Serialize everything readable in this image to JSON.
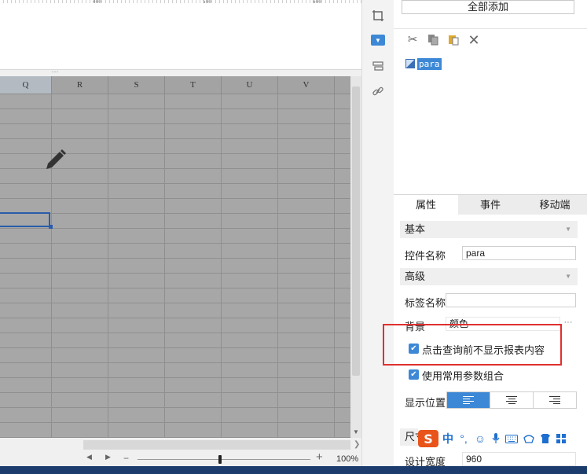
{
  "ruler": {
    "labels": [
      "400",
      "500",
      "600"
    ]
  },
  "grid": {
    "columns": [
      "Q",
      "R",
      "S",
      "T",
      "U",
      "V"
    ]
  },
  "zoom": {
    "minus": "−",
    "plus": "+",
    "percent": "100%",
    "level": 1.0
  },
  "tools": [
    "crop-icon",
    "widget-icon",
    "layers-icon",
    "link-icon"
  ],
  "right_panel": {
    "add_all_button": "全部添加",
    "edit_toolbar": [
      "cut-icon",
      "copy-icon",
      "paste-icon",
      "delete-icon"
    ],
    "tree": {
      "item_label": "para"
    },
    "tabs": [
      "属性",
      "事件",
      "移动端"
    ],
    "active_tab": "属性",
    "sections": {
      "basic": "基本",
      "advanced": "高级"
    },
    "fields": {
      "control_name_label": "控件名称",
      "control_name_value": "para",
      "tag_name_label": "标签名称",
      "tag_name_value": "",
      "background_label": "背景",
      "background_value": "颜色",
      "background_more": "···",
      "checkbox_hide_report": "点击查询前不显示报表内容",
      "checkbox_param_combo": "使用常用参数组合",
      "display_position_label": "显示位置",
      "size_section_label": "尺寸",
      "design_width_label": "设计宽度",
      "design_width_value": "960"
    },
    "ime_bar": {
      "logo": "S",
      "lang": "中",
      "punct": "°,"
    }
  },
  "colors": {
    "accent": "#3d88d6",
    "highlight": "#e03030",
    "grid_bg": "#a7a7a7"
  }
}
